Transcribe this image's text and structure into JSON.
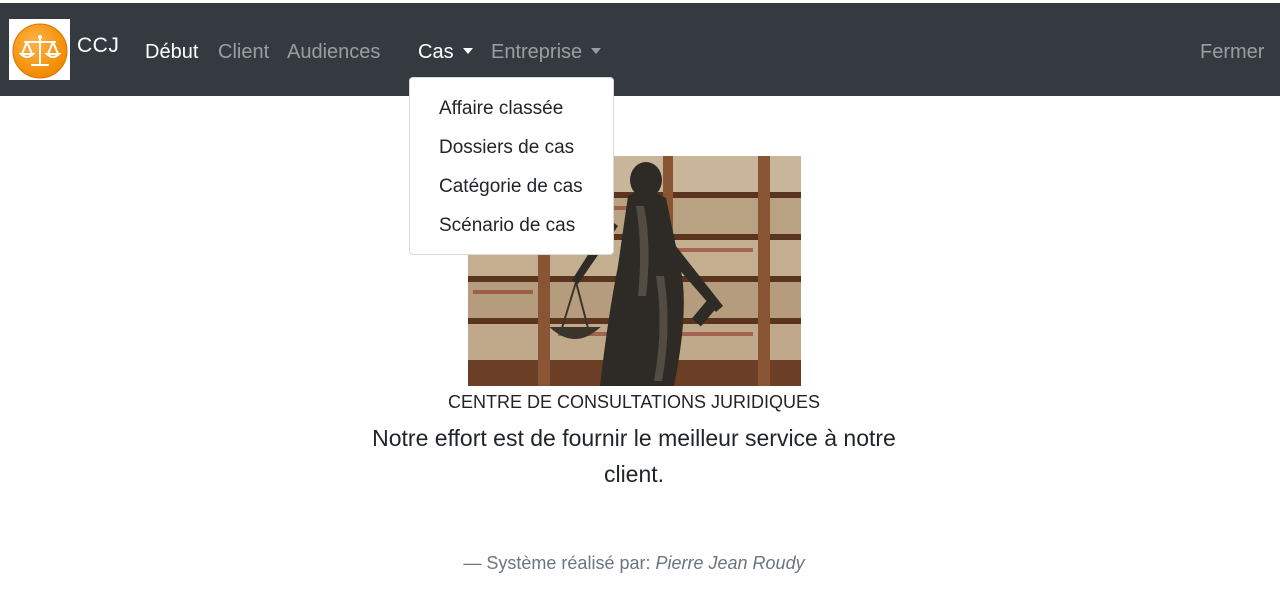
{
  "navbar": {
    "brand": "CCJ",
    "links": [
      {
        "label": "Début",
        "active": true
      },
      {
        "label": "Client",
        "active": false
      },
      {
        "label": "Audiences",
        "active": false
      }
    ],
    "dropdowns": [
      {
        "label": "Cas",
        "active": true,
        "open": true
      },
      {
        "label": "Entreprise",
        "active": false,
        "open": false
      }
    ],
    "logout": "Fermer"
  },
  "cas_menu": {
    "items": [
      "Affaire classée",
      "Dossiers de cas",
      "Catégorie de cas",
      "Scénario de cas"
    ]
  },
  "hero": {
    "title": "CENTRE DE CONSULTATIONS JURIDIQUES",
    "tagline": "Notre effort est de fournir le meilleur service à notre client."
  },
  "footer": {
    "prefix": "— Système réalisé par:",
    "author": "Pierre Jean Roudy"
  },
  "colors": {
    "navbar_bg": "#343a40",
    "logo_orange": "#f7941d"
  },
  "icons": {
    "logo": "scales-of-justice-icon",
    "image": "lady-justice-statue-photo"
  }
}
